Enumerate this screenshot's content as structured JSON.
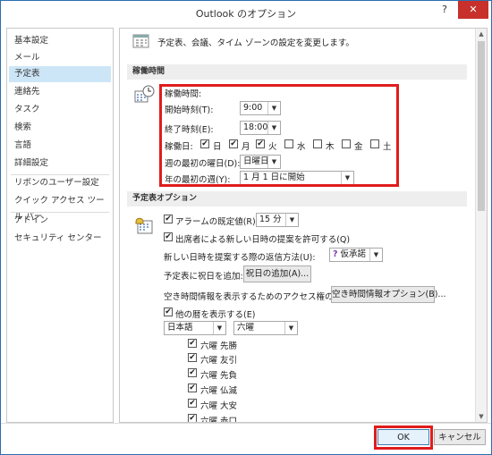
{
  "window": {
    "title": "Outlook のオプション",
    "help": "?",
    "close": "✕"
  },
  "sidebar": {
    "items": [
      {
        "label": "基本設定"
      },
      {
        "label": "メール"
      },
      {
        "label": "予定表"
      },
      {
        "label": "連絡先"
      },
      {
        "label": "タスク"
      },
      {
        "label": "検索"
      },
      {
        "label": "言語"
      },
      {
        "label": "詳細設定"
      },
      {
        "label": "リボンのユーザー設定"
      },
      {
        "label": "クイック アクセス ツール バー"
      },
      {
        "label": "アドイン"
      },
      {
        "label": "セキュリティ センター"
      }
    ],
    "selected": "予定表"
  },
  "intro": "予定表、会議、タイム ゾーンの設定を変更します。",
  "work_time": {
    "section": "稼働時間",
    "heading": "稼働時間:",
    "start_label": "開始時刻(T):",
    "start_value": "9:00",
    "end_label": "終了時刻(E):",
    "end_value": "18:00",
    "days_label": "稼働日:",
    "days": [
      {
        "label": "日",
        "checked": "✔"
      },
      {
        "label": "月",
        "checked": "✔"
      },
      {
        "label": "火",
        "checked": "✔"
      },
      {
        "label": "水",
        "checked": ""
      },
      {
        "label": "木",
        "checked": ""
      },
      {
        "label": "金",
        "checked": ""
      },
      {
        "label": "土",
        "checked": ""
      }
    ],
    "first_day_label": "週の最初の曜日(D):",
    "first_day_value": "日曜日",
    "first_week_label": "年の最初の週(Y):",
    "first_week_value": "1 月 1 日に開始"
  },
  "calendar_options": {
    "section": "予定表オプション",
    "alarm_label": "アラームの既定値(R):",
    "alarm_value": "15 分",
    "propose_label": "出席者による新しい日時の提案を許可する(Q)",
    "reply_label": "新しい日時を提案する際の返信方法(U):",
    "reply_value": "仮承諾",
    "reply_icon": "?",
    "holiday_label": "予定表に祝日を追加:",
    "holiday_button": "祝日の追加(A)...",
    "freebusy_label": "空き時間情報を表示するためのアクセス権の変更:",
    "freebusy_button": "空き時間情報オプション(B)...",
    "alt_cal_label": "他の暦を表示する(E)",
    "alt_cal_lang": "日本語",
    "alt_cal_type": "六曜",
    "rokuyo": [
      "六曜 先勝",
      "六曜 友引",
      "六曜 先負",
      "六曜 仏滅",
      "六曜 大安",
      "六曜 赤口"
    ]
  },
  "footer": {
    "ok": "OK",
    "cancel": "キャンセル"
  },
  "colors": {
    "highlight": "#e01c1c",
    "selected": "#cde6f7",
    "close": "#c7302b"
  }
}
